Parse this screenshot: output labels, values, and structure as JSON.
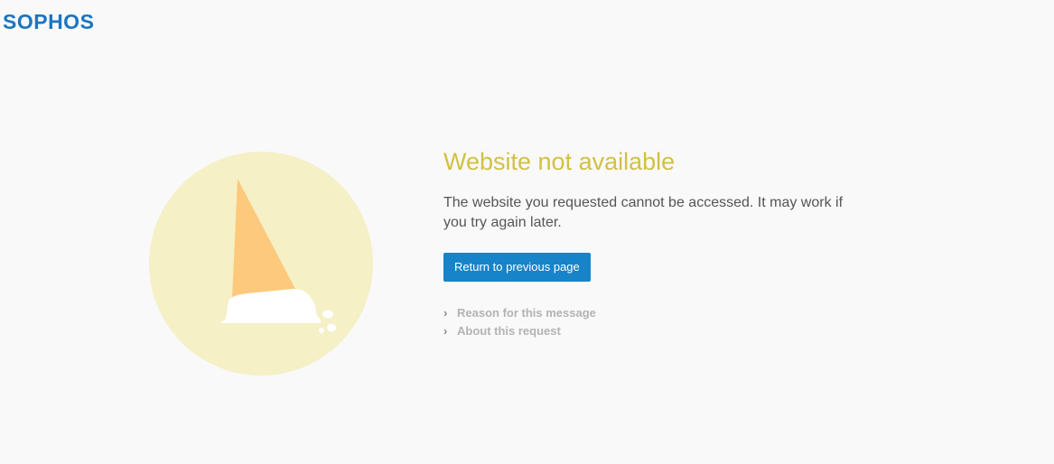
{
  "brand": {
    "logo_text": "SOPHOS",
    "logo_color": "#1a76c2"
  },
  "illustration": {
    "name": "melted-ice-cream-cone",
    "circle_color": "#f5f0c6",
    "cone_color": "#fdc97c",
    "cream_color": "#ffffff"
  },
  "main": {
    "title": "Website not available",
    "message": "The website you requested cannot be accessed. It may work if you try again later.",
    "back_button_label": "Return to previous page"
  },
  "details": {
    "items": [
      {
        "label": "Reason for this message",
        "icon": "chevron-right-icon"
      },
      {
        "label": "About this request",
        "icon": "chevron-right-icon"
      }
    ]
  },
  "colors": {
    "title": "#d2c142",
    "button": "#1783c9",
    "link": "#b3b3b3",
    "background": "#f9f9f9"
  }
}
